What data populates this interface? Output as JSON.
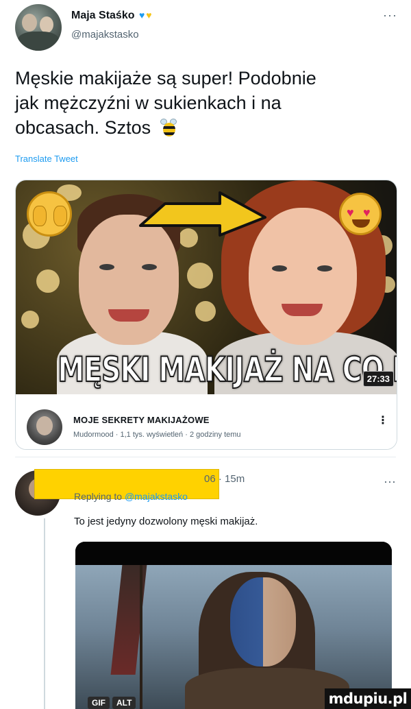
{
  "tweet": {
    "author_name": "Maja Staśko",
    "author_handle": "@majakstasko",
    "text_line1": "Męskie makijaże są super! Podobnie",
    "text_line2": "jak mężczyźni w sukienkach i na",
    "text_line3": "obcasach. Sztos",
    "translate_label": "Translate Tweet",
    "more_label": "···"
  },
  "video_card": {
    "thumbnail_title": "MĘSKI MAKIJAŻ NA CO DZIEŃ",
    "duration": "27:33",
    "video_title": "MOJE SEKRETY MAKIJAŻOWE",
    "meta": "Mudormood · 1,1 tys. wyświetleń · 2 godziny temu",
    "menu_label": "⋮"
  },
  "reply": {
    "stats": "06 · 15m",
    "replying_prefix": "Replying to ",
    "replying_handle": "@majakstasko",
    "text": "To jest jedyny dozwolony męski makijaż.",
    "more_label": "···"
  },
  "gif_card": {
    "badge_gif": "GIF",
    "badge_alt": "ALT"
  },
  "watermark": {
    "text": "mdupiu.pl"
  },
  "colors": {
    "accent": "#1d9bf0",
    "redaction": "#ffd200",
    "text_primary": "#0f1419",
    "text_secondary": "#536471"
  }
}
